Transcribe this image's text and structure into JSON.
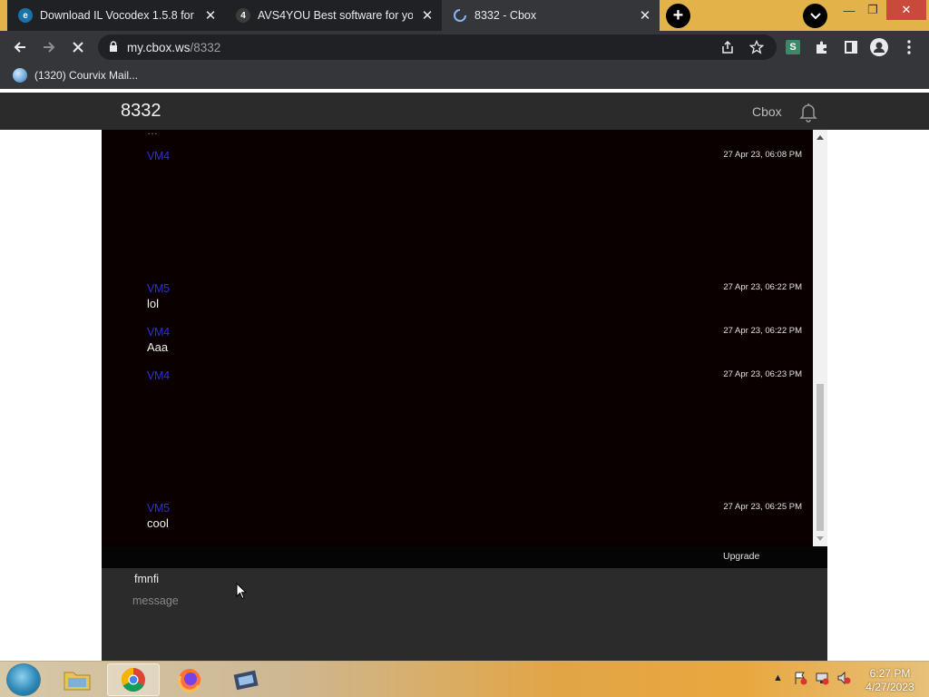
{
  "browser": {
    "tabs": [
      {
        "title": "Download IL Vocodex 1.5.8 for W",
        "state": "inactive"
      },
      {
        "title": "AVS4YOU Best software for you o",
        "state": "inactive",
        "favicon_text": "4"
      },
      {
        "title": "8332 - Cbox",
        "state": "active"
      }
    ],
    "new_tab_label": "+",
    "url_host": "my.cbox.ws",
    "url_path": "/8332",
    "bookmark": "(1320) Courvix Mail..."
  },
  "app": {
    "room_title": "8332",
    "brand": "Cbox",
    "upgrade_label": "Upgrade"
  },
  "messages": [
    {
      "user": "VM4",
      "time": "27 Apr 23, 06:08 PM",
      "text": ""
    },
    {
      "user": "VM5",
      "time": "27 Apr 23, 06:22 PM",
      "text": "lol"
    },
    {
      "user": "VM4",
      "time": "27 Apr 23, 06:22 PM",
      "text": "Aaa"
    },
    {
      "user": "VM4",
      "time": "27 Apr 23, 06:23 PM",
      "text": ""
    },
    {
      "user": "VM5",
      "time": "27 Apr 23, 06:25 PM",
      "text": "cool"
    }
  ],
  "composer": {
    "name": "fmnfi",
    "placeholder": "message"
  },
  "taskbar": {
    "time": "6:27 PM",
    "date": "4/27/2023"
  },
  "colors": {
    "tabstrip": "#e3b34a",
    "chrome_dark": "#35363a",
    "chat_bg": "#0a0000",
    "username": "#2f2fd8"
  }
}
